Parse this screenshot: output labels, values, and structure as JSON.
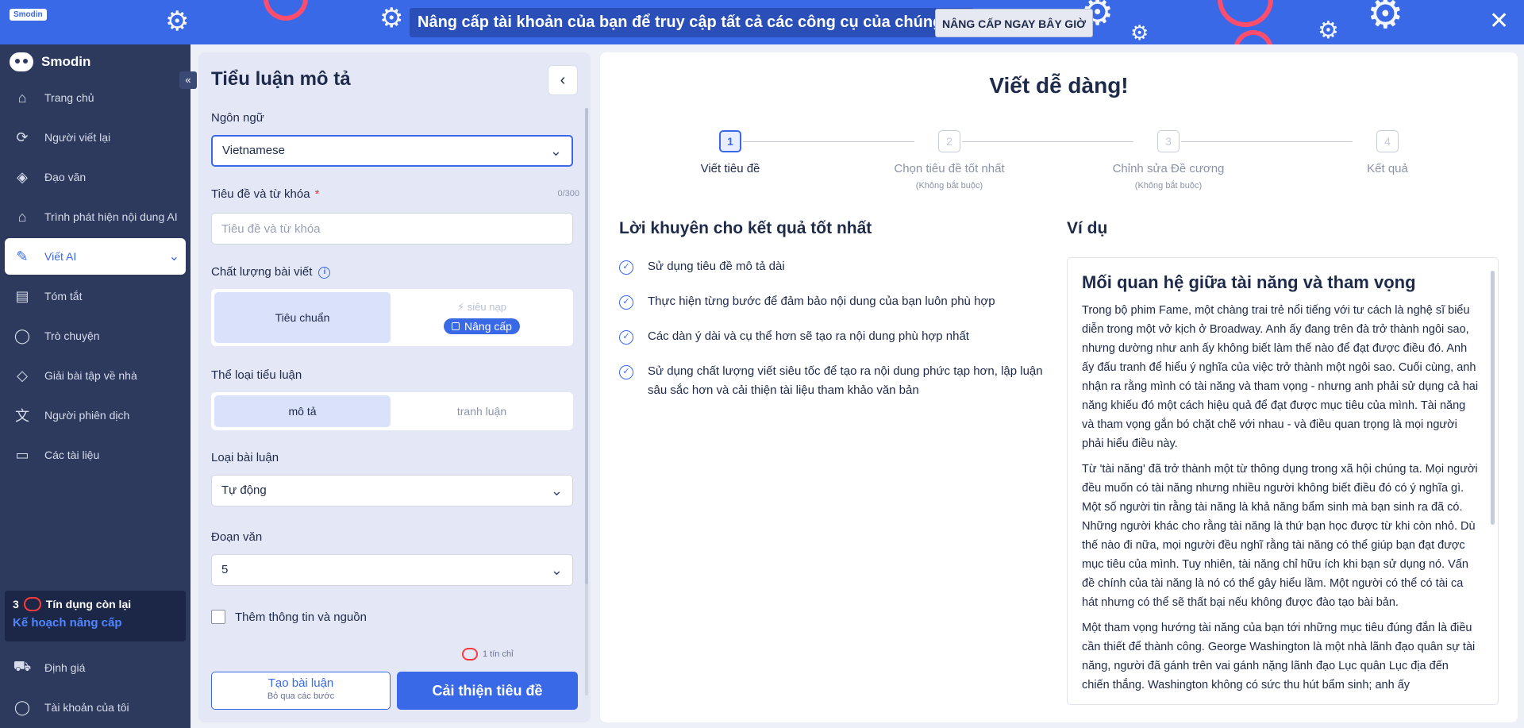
{
  "banner": {
    "logo_text": "Smodin",
    "promo": "Nâng cấp tài khoản của bạn để truy cập tất cả các công cụ của chúng tôi",
    "upgrade_button": "NÂNG CẤP NGAY BÂY GIỜ",
    "close": "✕"
  },
  "sidebar": {
    "brand": "Smodin",
    "items": [
      {
        "label": "Trang chủ",
        "icon": "home-icon"
      },
      {
        "label": "Người viết lại",
        "icon": "rewriter-icon"
      },
      {
        "label": "Đạo văn",
        "icon": "plagiarism-icon"
      },
      {
        "label": "Trình phát hiện nội dung AI",
        "icon": "ai-detector-icon"
      },
      {
        "label": "Viết AI",
        "icon": "ai-writer-icon"
      },
      {
        "label": "Tóm tắt",
        "icon": "summarizer-icon"
      },
      {
        "label": "Trò chuyện",
        "icon": "chat-icon"
      },
      {
        "label": "Giải bài tập về nhà",
        "icon": "homework-icon"
      },
      {
        "label": "Người phiên dịch",
        "icon": "translate-icon"
      },
      {
        "label": "Các tài liệu",
        "icon": "folder-icon"
      }
    ],
    "credits_count": "3",
    "credits_label": "Tín dụng còn lại",
    "plan_link": "Kế hoạch nâng cấp",
    "bottom_items": [
      {
        "label": "Định giá",
        "icon": "cart-icon"
      },
      {
        "label": "Tài khoản của tôi",
        "icon": "user-icon"
      }
    ]
  },
  "form": {
    "title": "Tiểu luận mô tả",
    "language_label": "Ngôn ngữ",
    "language_value": "Vietnamese",
    "title_label": "Tiêu đề và từ khóa",
    "title_required": "*",
    "title_counter": "0/300",
    "title_placeholder": "Tiêu đề và từ khóa",
    "quality_label": "Chất lượng bài viết",
    "quality_standard": "Tiêu chuẩn",
    "quality_super": "siêu nạp",
    "quality_upgrade": "Nâng cấp",
    "genre_label": "Thể loại tiểu luận",
    "genre_descriptive": "mô tả",
    "genre_argument": "tranh luận",
    "type_label": "Loại bài luận",
    "type_value": "Tự động",
    "paragraph_label": "Đoạn văn",
    "paragraph_value": "5",
    "extra_label": "Thêm thông tin và nguồn",
    "cost": "1 tín chỉ",
    "create_button": "Tạo bài luận",
    "create_sub": "Bỏ qua các bước",
    "improve_button": "Cải thiện tiêu đề"
  },
  "content": {
    "hero": "Viết dễ dàng!",
    "steps": [
      {
        "num": "1",
        "label": "Viết tiêu đề",
        "sub": ""
      },
      {
        "num": "2",
        "label": "Chọn tiêu đề tốt nhất",
        "sub": "(Không bắt buộc)"
      },
      {
        "num": "3",
        "label": "Chỉnh sửa Đề cương",
        "sub": "(Không bắt buộc)"
      },
      {
        "num": "4",
        "label": "Kết quả",
        "sub": ""
      }
    ],
    "tips_title": "Lời khuyên cho kết quả tốt nhất",
    "tips": [
      "Sử dụng tiêu đề mô tả dài",
      "Thực hiện từng bước để đảm bảo nội dung của bạn luôn phù hợp",
      "Các dàn ý dài và cụ thể hơn sẽ tạo ra nội dung phù hợp nhất",
      "Sử dụng chất lượng viết siêu tốc để tạo ra nội dung phức tạp hơn, lập luận sâu sắc hơn và cải thiện tài liệu tham khảo văn bản"
    ],
    "example_title": "Ví dụ",
    "example_heading": "Mối quan hệ giữa tài năng và tham vọng",
    "example_paragraphs": [
      "Trong bộ phim Fame, một chàng trai trẻ nổi tiếng với tư cách là nghệ sĩ biểu diễn trong một vở kịch ở Broadway. Anh ấy đang trên đà trở thành ngôi sao, nhưng dường như anh ấy không biết làm thế nào để đạt được điều đó. Anh ấy đấu tranh để hiểu ý nghĩa của việc trở thành một ngôi sao. Cuối cùng, anh nhận ra rằng mình có tài năng và tham vọng - nhưng anh phải sử dụng cả hai năng khiếu đó một cách hiệu quả để đạt được mục tiêu của mình. Tài năng và tham vọng gắn bó chặt chẽ với nhau - và điều quan trọng là mọi người phải hiểu điều này.",
      "Từ 'tài năng' đã trở thành một từ thông dụng trong xã hội chúng ta. Mọi người đều muốn có tài năng nhưng nhiều người không biết điều đó có ý nghĩa gì. Một số người tin rằng tài năng là khả năng bẩm sinh mà bạn sinh ra đã có. Những người khác cho rằng tài năng là thứ bạn học được từ khi còn nhỏ. Dù thế nào đi nữa, mọi người đều nghĩ rằng tài năng có thể giúp bạn đạt được mục tiêu của mình. Tuy nhiên, tài năng chỉ hữu ích khi bạn sử dụng nó. Vấn đề chính của tài năng là nó có thể gây hiểu lầm. Một người có thể có tài ca hát nhưng có thể sẽ thất bại nếu không được đào tạo bài bản.",
      "Một tham vọng hướng tài năng của bạn tới những mục tiêu đúng đắn là điều cần thiết để thành công. George Washington là một nhà lãnh đạo quân sự tài năng, người đã gánh trên vai gánh nặng lãnh đạo Lục quân Lục địa đến chiến thắng. Washington không có sức thu hút bẩm sinh; anh ấy"
    ]
  }
}
